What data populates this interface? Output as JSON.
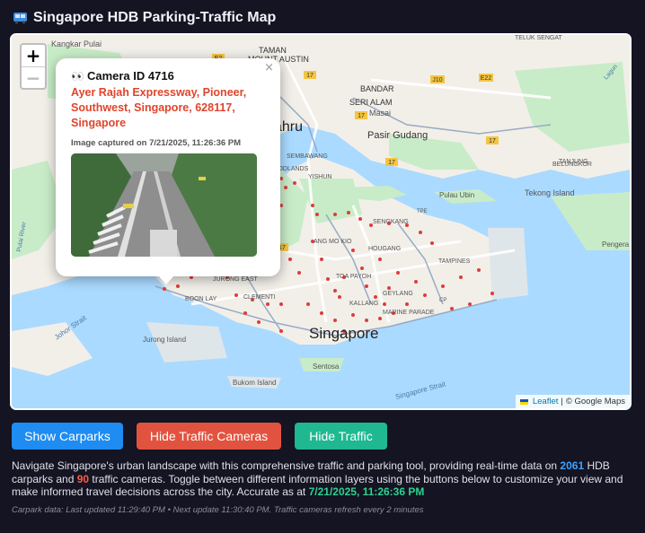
{
  "title": "Singapore HDB Parking-Traffic Map",
  "title_icon": "bus-icon",
  "map": {
    "zoom_in": "+",
    "zoom_out": "−",
    "labels": [
      {
        "key": "kangkar",
        "text": "Kangkar Pulai"
      },
      {
        "key": "taman",
        "text": "TAMAN"
      },
      {
        "key": "mount",
        "text": "MOUNT AUSTIN"
      },
      {
        "key": "teluk",
        "text": "TELUK SENGAT"
      },
      {
        "key": "bandar",
        "text": "BANDAR"
      },
      {
        "key": "seri",
        "text": "SERI ALAM"
      },
      {
        "key": "masai",
        "text": "Masai"
      },
      {
        "key": "pasir",
        "text": "Pasir Gudang"
      },
      {
        "key": "ahru",
        "text": "ahru"
      },
      {
        "key": "sembawang",
        "text": "SEMBAWANG"
      },
      {
        "key": "woodlands",
        "text": "OODLANDS"
      },
      {
        "key": "yishun",
        "text": "YISHUN"
      },
      {
        "key": "tanjung",
        "text": "TANJUNG"
      },
      {
        "key": "belungkor",
        "text": "BELUNGKOR"
      },
      {
        "key": "pulau_ubin",
        "text": "Pulau Ubin"
      },
      {
        "key": "tekong",
        "text": "Tekong Island"
      },
      {
        "key": "sengkang",
        "text": "SENGKANG"
      },
      {
        "key": "ang_mo_kio",
        "text": "ANG MO KIO"
      },
      {
        "key": "hougang",
        "text": "HOUGANG"
      },
      {
        "key": "tampines",
        "text": "TAMPINES"
      },
      {
        "key": "toa_payoh",
        "text": "TOA PAYOH"
      },
      {
        "key": "jurong_east",
        "text": "JURONG EAST"
      },
      {
        "key": "clementi",
        "text": "CLEMENTI"
      },
      {
        "key": "boon_lay",
        "text": "BOON LAY"
      },
      {
        "key": "geylang",
        "text": "GEYLANG"
      },
      {
        "key": "kallang",
        "text": "KALLANG"
      },
      {
        "key": "marine",
        "text": "MARINE PARADE"
      },
      {
        "key": "singapore",
        "text": "Singapore"
      },
      {
        "key": "jurong_island",
        "text": "Jurong Island"
      },
      {
        "key": "sentosa",
        "text": "Sentosa"
      },
      {
        "key": "bukom",
        "text": "Bukom Island"
      },
      {
        "key": "johor_strait",
        "text": "Johor Strait"
      },
      {
        "key": "sg_strait",
        "text": "Singapore Strait"
      },
      {
        "key": "pulai",
        "text": "Pulai River"
      },
      {
        "key": "pengera",
        "text": "Pengera"
      },
      {
        "key": "lagun",
        "text": "Lagun"
      },
      {
        "key": "tpe",
        "text": "TPE"
      },
      {
        "key": "cp",
        "text": "CP"
      }
    ],
    "road_shields": [
      "E2",
      "17",
      "J10",
      "E22",
      "17",
      "17",
      "17",
      "17"
    ]
  },
  "popup": {
    "close": "×",
    "eyes_icon": "👀",
    "camera_label": "Camera ID 4716",
    "location": "Ayer Rajah Expressway, Pioneer, Southwest, Singapore, 628117, Singapore",
    "captured": "Image captured on 7/21/2025, 11:26:36 PM"
  },
  "attribution": {
    "leaflet": "Leaflet",
    "sep": "|",
    "google": "© Google Maps"
  },
  "buttons": {
    "carparks": "Show Carparks",
    "cameras": "Hide Traffic Cameras",
    "traffic": "Hide Traffic"
  },
  "description": {
    "part1": "Navigate Singapore's urban landscape with this comprehensive traffic and parking tool, providing real-time data on ",
    "carpark_count": "2061",
    "part2": " HDB carparks and ",
    "camera_count": "90",
    "part3": " traffic cameras. Toggle between different information layers using the buttons below to customize your view and make informed travel decisions across the city. Accurate as at ",
    "timestamp": "7/21/2025, 11:26:36 PM"
  },
  "footer": "Carpark data: Last updated 11:29:40 PM • Next update 11:30:40 PM. Traffic cameras refresh every 2 minutes",
  "colors": {
    "button_blue": "#1e8cf1",
    "button_red": "#e2533f",
    "button_green": "#1fb891",
    "camera_marker": "#e03b3b",
    "water": "#aadaff",
    "land": "#f2efe9",
    "park": "#c8ecc8"
  }
}
